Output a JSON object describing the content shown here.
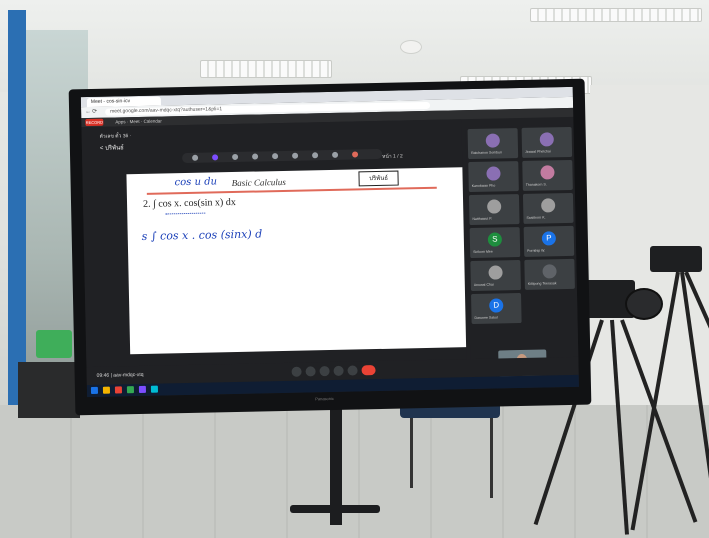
{
  "browser": {
    "tab_title": "Meet - cos-sin-icv",
    "url": "meet.google.com/aav-mdqc-xtq?authuser=1&pli=1",
    "rec_label": "RECORD",
    "bookmark_label": "Apps · Meet · Calendar"
  },
  "document": {
    "header": "ตัวเลข ตั๋ว 36 ·",
    "back_label": "< ปริพันธ์",
    "page_info": "หน้า 1 / 2"
  },
  "whiteboard": {
    "title": "Basic Calculus",
    "ink_line1": "cos u du",
    "box_label": "ปริพันธ์",
    "question": "2.  ∫ cos x. cos(sin x) dx",
    "ink_line2": "s   ∫ cos x . cos (sinx) d"
  },
  "meet": {
    "time": "09:46 | aav-mdqc-xtq",
    "participants": [
      {
        "initial": "",
        "color": "#8a6fb3",
        "name": "Ratchanon Sombun"
      },
      {
        "initial": "",
        "color": "#8a6fb3",
        "name": "Jirawat Phetchai"
      },
      {
        "initial": "",
        "color": "#8a6fb3",
        "name": "Kanokwan Pho"
      },
      {
        "initial": "",
        "color": "#c27ba0",
        "name": "Thanakorn S."
      },
      {
        "initial": "",
        "color": "#9e9e9e",
        "name": "Natthawut P."
      },
      {
        "initial": "",
        "color": "#9e9e9e",
        "name": "Sasithorn K."
      },
      {
        "initial": "S",
        "color": "#1e8e3e",
        "name": "Sirikorn Mee"
      },
      {
        "initial": "P",
        "color": "#1a73e8",
        "name": "Pornthip W."
      },
      {
        "initial": "",
        "color": "#9e9e9e",
        "name": "Anuwat Chai"
      },
      {
        "initial": "",
        "color": "#5f6368",
        "name": "Kittipong Teerasak"
      },
      {
        "initial": "D",
        "color": "#1a73e8",
        "name": "Darunee Sakul"
      }
    ]
  },
  "monitor": {
    "brand": "Panasonic"
  }
}
